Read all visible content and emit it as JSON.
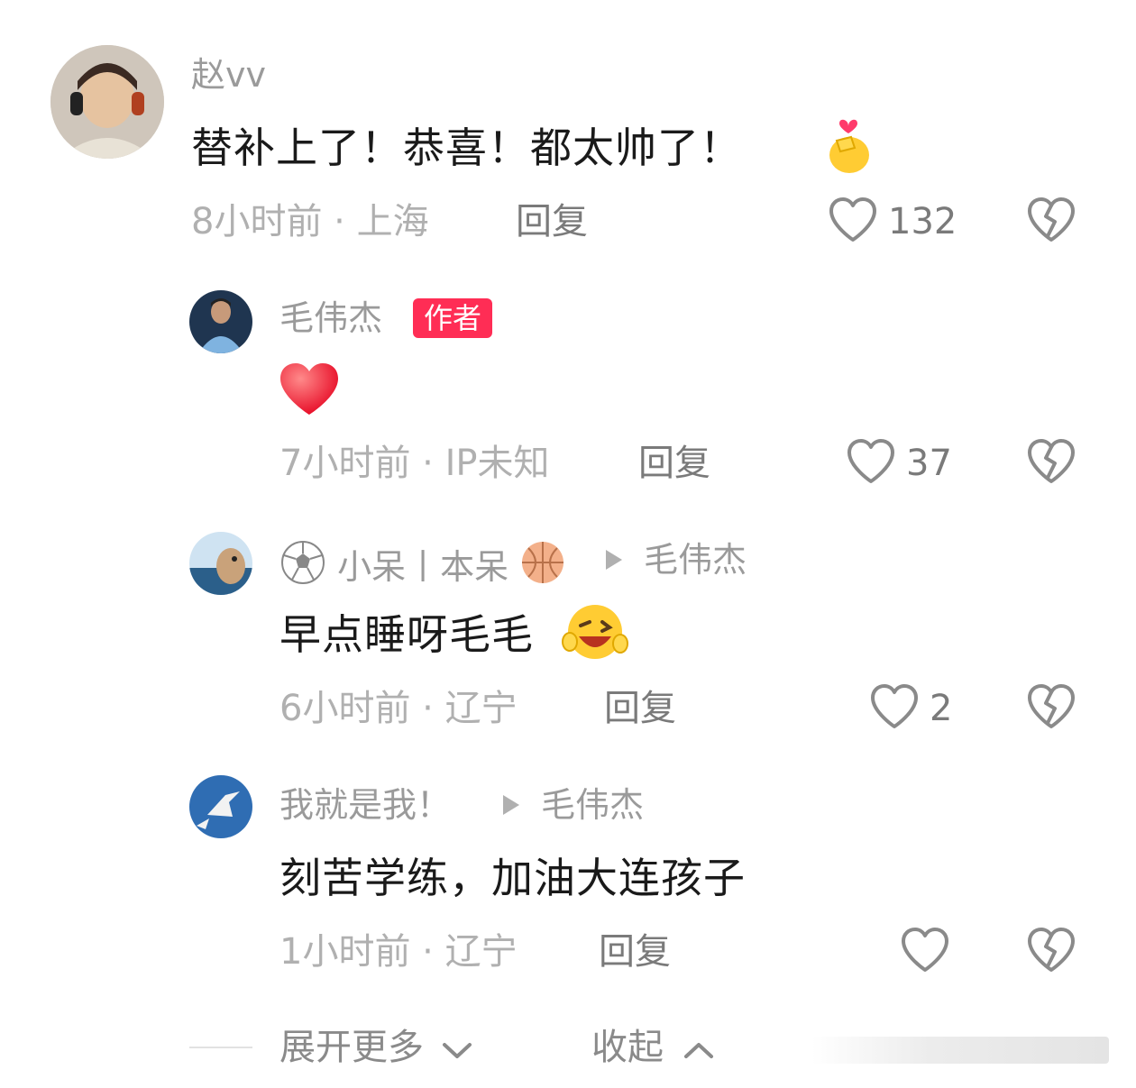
{
  "comments": [
    {
      "username": "赵vv",
      "content": "替补上了！恭喜！都太帅了！",
      "time": "8小时前",
      "location": "上海",
      "reply_label": "回复",
      "likes": "132",
      "emoji": "finger-heart-icon"
    },
    {
      "username": "毛伟杰",
      "badge": "作者",
      "emoji": "red-heart-icon",
      "time": "7小时前",
      "location": "IP未知",
      "reply_label": "回复",
      "likes": "37"
    },
    {
      "username": "小呆丨本呆",
      "reply_to": "毛伟杰",
      "content": "早点睡呀毛毛",
      "time": "6小时前",
      "location": "辽宁",
      "reply_label": "回复",
      "likes": "2",
      "emoji": "wink-laugh-icon"
    },
    {
      "username": "我就是我！",
      "reply_to": "毛伟杰",
      "content": "刻苦学练，加油大连孩子",
      "time": "1小时前",
      "location": "辽宁",
      "reply_label": "回复",
      "likes": ""
    }
  ],
  "footer": {
    "expand_label": "展开更多",
    "collapse_label": "收起"
  },
  "colors": {
    "badge": "#ff2d55",
    "meta": "#b0b0b0",
    "username": "#9a9a9a",
    "content": "#1a1a1a"
  }
}
